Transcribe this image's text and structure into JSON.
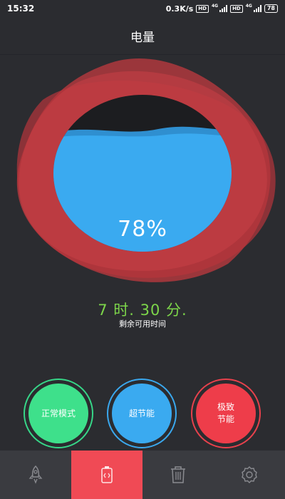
{
  "status_bar": {
    "time": "15:32",
    "net_speed": "0.3K/s",
    "hd_badge": "HD",
    "net_type": "4G",
    "battery": "78"
  },
  "header": {
    "title": "电量"
  },
  "battery_gauge": {
    "percent_text": "78%",
    "level_fraction": 0.78
  },
  "remaining": {
    "time_text": "7 时. 30 分.",
    "caption": "剩余可用时间"
  },
  "modes": {
    "normal_label": "正常模式",
    "super_label": "超节能",
    "extreme_line1": "极致",
    "extreme_line2": "节能"
  },
  "bottom_nav": {
    "items": [
      "rocket-icon",
      "battery-icon",
      "trash-icon",
      "settings-icon"
    ],
    "active_index": 1
  },
  "colors": {
    "background": "#2b2c30",
    "water": "#3aa8ee",
    "petals": "#c23a3f",
    "time_green": "#7dd64a",
    "normal_mode": "#3ee08b",
    "extreme_mode": "#ee3d4a",
    "nav_active": "#f04a55"
  }
}
